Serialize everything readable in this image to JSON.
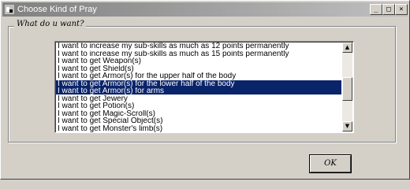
{
  "window": {
    "title": "Choose Kind of Pray",
    "minimize_glyph": "_",
    "maximize_glyph": "□",
    "close_glyph": "×"
  },
  "group": {
    "label": "What do u want?"
  },
  "list": {
    "items": [
      "I want to increase my sub-skills as much as 12 points permanently",
      "I want to increase my sub-skills as much as 15 points permanently",
      "I want to get Weapon(s)",
      "I want to get Shield(s)",
      "I want to get Armor(s) for the upper half of the body",
      "I want to get Armor(s) for the lower half of the body",
      "I want to get Armor(s) for arms",
      "I want to get Jewery",
      "I want to get Potion(s)",
      "I want to get Magic-Scroll(s)",
      "I want to get Special Object(s)",
      "I want to get Monster's limb(s)"
    ],
    "selected_indices": [
      5,
      6
    ],
    "scroll_up_glyph": "▲",
    "scroll_down_glyph": "▼"
  },
  "ok_button": {
    "label": "OK"
  }
}
